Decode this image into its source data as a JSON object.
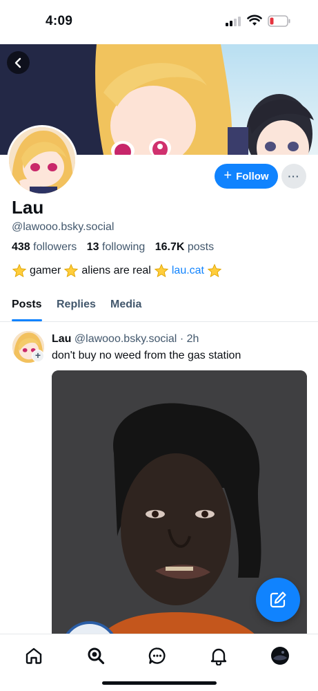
{
  "status_bar": {
    "time": "4:09",
    "icons": [
      "signal-icon",
      "wifi-icon",
      "battery-low-icon"
    ]
  },
  "profile": {
    "display_name": "Lau",
    "handle": "@lawooo.bsky.social",
    "stats": {
      "followers_count": "438",
      "followers_label": "followers",
      "following_count": "13",
      "following_label": "following",
      "posts_count": "16.7K",
      "posts_label": "posts"
    },
    "bio": {
      "part1": "gamer",
      "part2": "aliens are real",
      "link": "lau.cat"
    },
    "follow_label": "Follow",
    "more_label": "···"
  },
  "tabs": [
    {
      "label": "Posts",
      "active": true
    },
    {
      "label": "Replies",
      "active": false
    },
    {
      "label": "Media",
      "active": false
    }
  ],
  "post": {
    "author": "Lau",
    "handle": "@lawooo.bsky.social",
    "separator": "·",
    "time": "2h",
    "text": "don't buy no weed from the gas station",
    "badge": "+"
  },
  "bottom_nav": [
    {
      "icon": "home-icon"
    },
    {
      "icon": "search-icon"
    },
    {
      "icon": "chat-icon"
    },
    {
      "icon": "bell-icon"
    },
    {
      "icon": "profile-avatar-icon"
    }
  ],
  "colors": {
    "accent": "#1083fe",
    "muted_text": "#42576c",
    "text": "#0b0f14",
    "battery_low": "#e5343f"
  }
}
